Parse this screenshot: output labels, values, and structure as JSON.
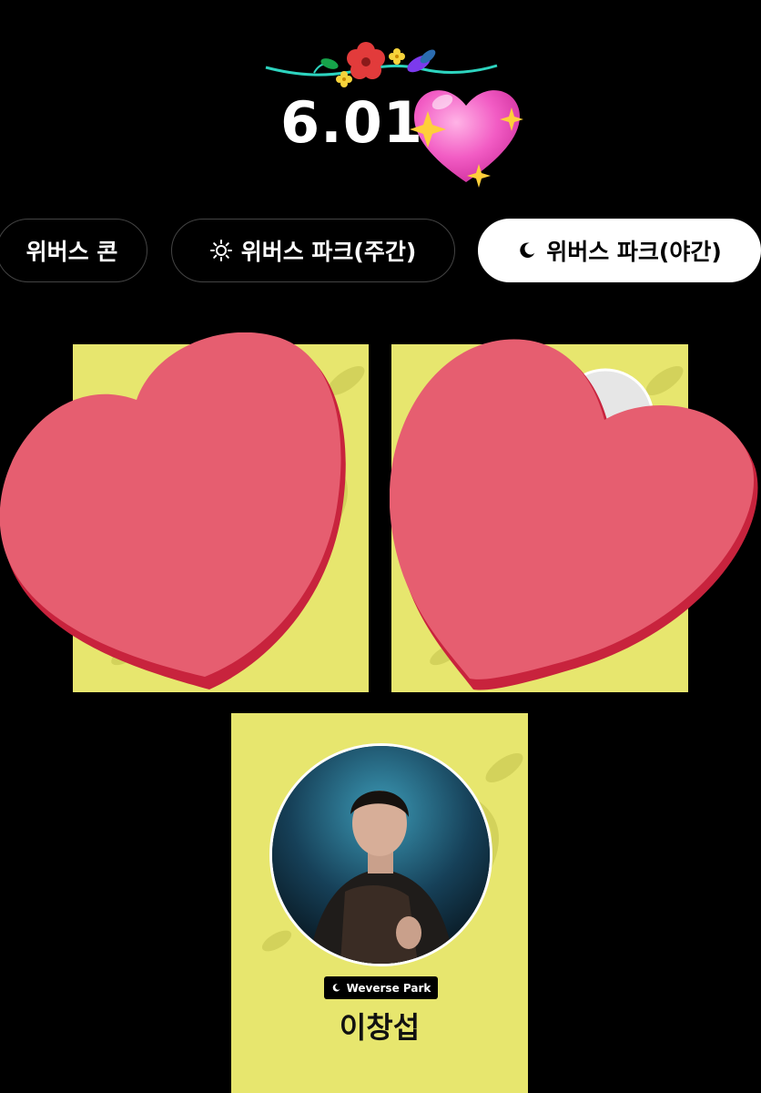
{
  "header": {
    "date": "6.01"
  },
  "tabs": [
    {
      "label": "위버스 콘",
      "icon": "",
      "active": false
    },
    {
      "label": "위버스 파크(주간)",
      "icon": "sun-icon",
      "active": false
    },
    {
      "label": "위버스 파크(야간)",
      "icon": "moon-icon",
      "active": true
    }
  ],
  "cards": [
    {
      "id": "card-1",
      "hidden_by": "heart-sticker"
    },
    {
      "id": "card-2",
      "hidden_by": "heart-sticker"
    },
    {
      "id": "card-3",
      "badge": "Weverse Park",
      "badge_icon": "moon-icon",
      "name": "이창섭"
    }
  ],
  "colors": {
    "background": "#000000",
    "card": "#e7e66e",
    "heart": "#e65e70",
    "heart_shadow": "#c8233d",
    "active_tab": "#ffffff"
  }
}
